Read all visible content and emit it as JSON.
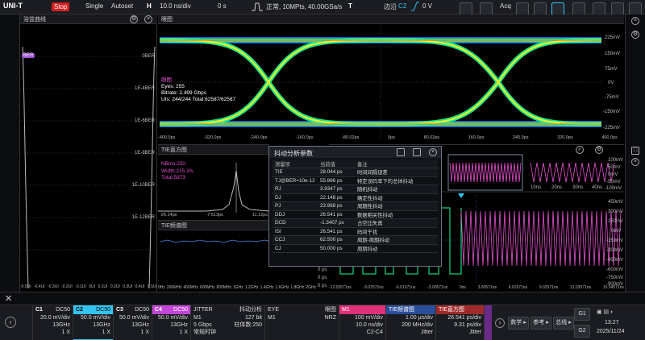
{
  "topbar": {
    "logo": "UNI-T",
    "run_state": "Stop",
    "single": "Single",
    "autoset": "Autoset",
    "h_label": "H",
    "timebase": "10.0 ns/div",
    "delay": "0 s",
    "acq_mode": "正常, 10MPts, 40.00GSa/s",
    "t_label": "T",
    "trig_type": "边沿",
    "trig_src": "C2",
    "trig_level": "0 V",
    "acq_btn": "Acq"
  },
  "bathtub": {
    "title": "浴盆曲线",
    "marker": "BER",
    "yticks": [
      "0BER",
      "1E-4BER",
      "1E-6BER",
      "1E-8BER",
      "1E-10BER",
      "1E-12BER"
    ],
    "xticks": [
      "-0.5UI",
      "-0.4UI",
      "-0.3UI",
      "-0.2UI",
      "-0.1UI",
      "0UI",
      "0.1UI",
      "0.2UI",
      "0.3UI",
      "0.4UI",
      "0.5UI"
    ]
  },
  "eye": {
    "title": "眼图",
    "info_title": "眼图",
    "eyes": "Eyes: 255",
    "bitrate": "Bitrate: 2.499 Gbps",
    "uis": "UIs: 244/244",
    "total": "Total:62587/62587",
    "yticks": [
      "225mV",
      "150mV",
      "75mV",
      "0V",
      "-75mV",
      "-150mV",
      "-225mV"
    ],
    "xticks": [
      "-400.0ps",
      "-320.0ps",
      "-240.0ps",
      "-160.0ps",
      "-80.02ps",
      "0ps",
      "80.02ps",
      "160.0ps",
      "240.0ps",
      "320.0ps",
      "400.0ps"
    ]
  },
  "tie_hist": {
    "title": "TIE直方图",
    "nbins": "NBins:250",
    "width": "Width:215.1fs",
    "total": "Total:5873",
    "xticks": [
      "-26.14ps",
      "-7.513ps",
      "11.12ps"
    ]
  },
  "tie_spec": {
    "title": "TIE频谱图",
    "xticks": [
      "0Hz",
      "200MHz",
      "400MHz",
      "600MHz",
      "800MHz",
      "1GHz",
      "1.2GHz",
      "1.4GHz",
      "1.6GHz",
      "1.8GHz",
      "2GHz"
    ],
    "yticks": [
      "0 ps",
      "0 ps",
      "0 ps"
    ]
  },
  "wave": {
    "yticks_top": [
      "100mV",
      "50mV",
      "0mV",
      "-50mV",
      "-100mV"
    ],
    "xticks_top": [
      "10ns",
      "20ns",
      "30ns",
      "40ns"
    ],
    "yticks_main": [
      "450mV",
      "300mV",
      "150mV",
      "0mV",
      "-150mV",
      "-300mV",
      "-450mV",
      "-600mV",
      "-750mV",
      "-900mV"
    ],
    "xticks_main": [
      "-12.03571ns",
      "-9.02571ns",
      "-6.01571ns",
      "-3.00571ns",
      "0ns",
      "3.00571ns",
      "6.01571ns",
      "9.02571ns",
      "12.03571ns",
      "15.04571ns"
    ]
  },
  "jitter_table": {
    "title": "抖动分析参数",
    "headers": [
      "测量项",
      "当前值",
      "备注"
    ],
    "rows": [
      [
        "TIE",
        "28.044 ps",
        "时间间隔误差"
      ],
      [
        "TJ@BER=10e-12",
        "55.886 ps",
        "特定误码率下的总体抖动"
      ],
      [
        "RJ",
        "3.9347 ps",
        "随机抖动"
      ],
      [
        "DJ",
        "22.148 ps",
        "确定性抖动"
      ],
      [
        "PJ",
        "23.968 ps",
        "周期性抖动"
      ],
      [
        "DDJ",
        "26.541 ps",
        "数据相关性抖动"
      ],
      [
        "DCD",
        "-1.3407 ps",
        "占空比失真"
      ],
      [
        "ISI",
        "26.541 ps",
        "码间干扰"
      ],
      [
        "CCJ",
        "62.500 ps",
        "周期-周期抖动"
      ],
      [
        "CJ",
        "50.000 ps",
        "周期抖动"
      ]
    ]
  },
  "bottom": {
    "c1": {
      "name": "C1",
      "coupling": "DC50",
      "scale": "20.0 mV/div",
      "bw": "13GHz",
      "probe": "1 X"
    },
    "c2": {
      "name": "C2",
      "coupling": "DC50",
      "scale": "50.0 mV/div",
      "bw": "13GHz",
      "probe": "1 X"
    },
    "c3": {
      "name": "C3",
      "coupling": "DC50",
      "scale": "50.0 mV/div",
      "bw": "13GHz",
      "probe": "1 X"
    },
    "c4": {
      "name": "C4",
      "coupling": "DC50",
      "scale": "50.0 mV/div",
      "bw": "13GHz",
      "probe": "1 X"
    },
    "jitter": {
      "name": "JITTER",
      "mode": "抖动分析",
      "src": "M1",
      "bits": "127 bit",
      "rate": "5 Gbps",
      "bins": "柱体数:250",
      "clock": "常规时钟"
    },
    "eye": {
      "name": "EYE",
      "mode": "眼图",
      "src": "M1",
      "code": "NRZ"
    },
    "m1": {
      "name": "M1",
      "scale": "100 mV/div",
      "time": "10.0 ns/div",
      "src": "C2-C4"
    },
    "spec": {
      "name": "TIE频谱图",
      "scale": "1.00 μs/div",
      "freq": "200 MHz/div",
      "type": "Jitter"
    },
    "hist": {
      "name": "TIE直方图",
      "scale": "26.541 ps/div",
      "sub": "9.31 ps/div",
      "type": "Jitter"
    },
    "math": "数学",
    "ref": "参考",
    "bus": "总线",
    "g1": "G1",
    "g2": "G2",
    "time": "13:27",
    "date": "2025/11/24"
  },
  "colors": {
    "c1": "#f5d800",
    "c2": "#33c4f0",
    "c3": "#e84fd0",
    "c4": "#b06ef0",
    "m1": "#e0307a"
  }
}
